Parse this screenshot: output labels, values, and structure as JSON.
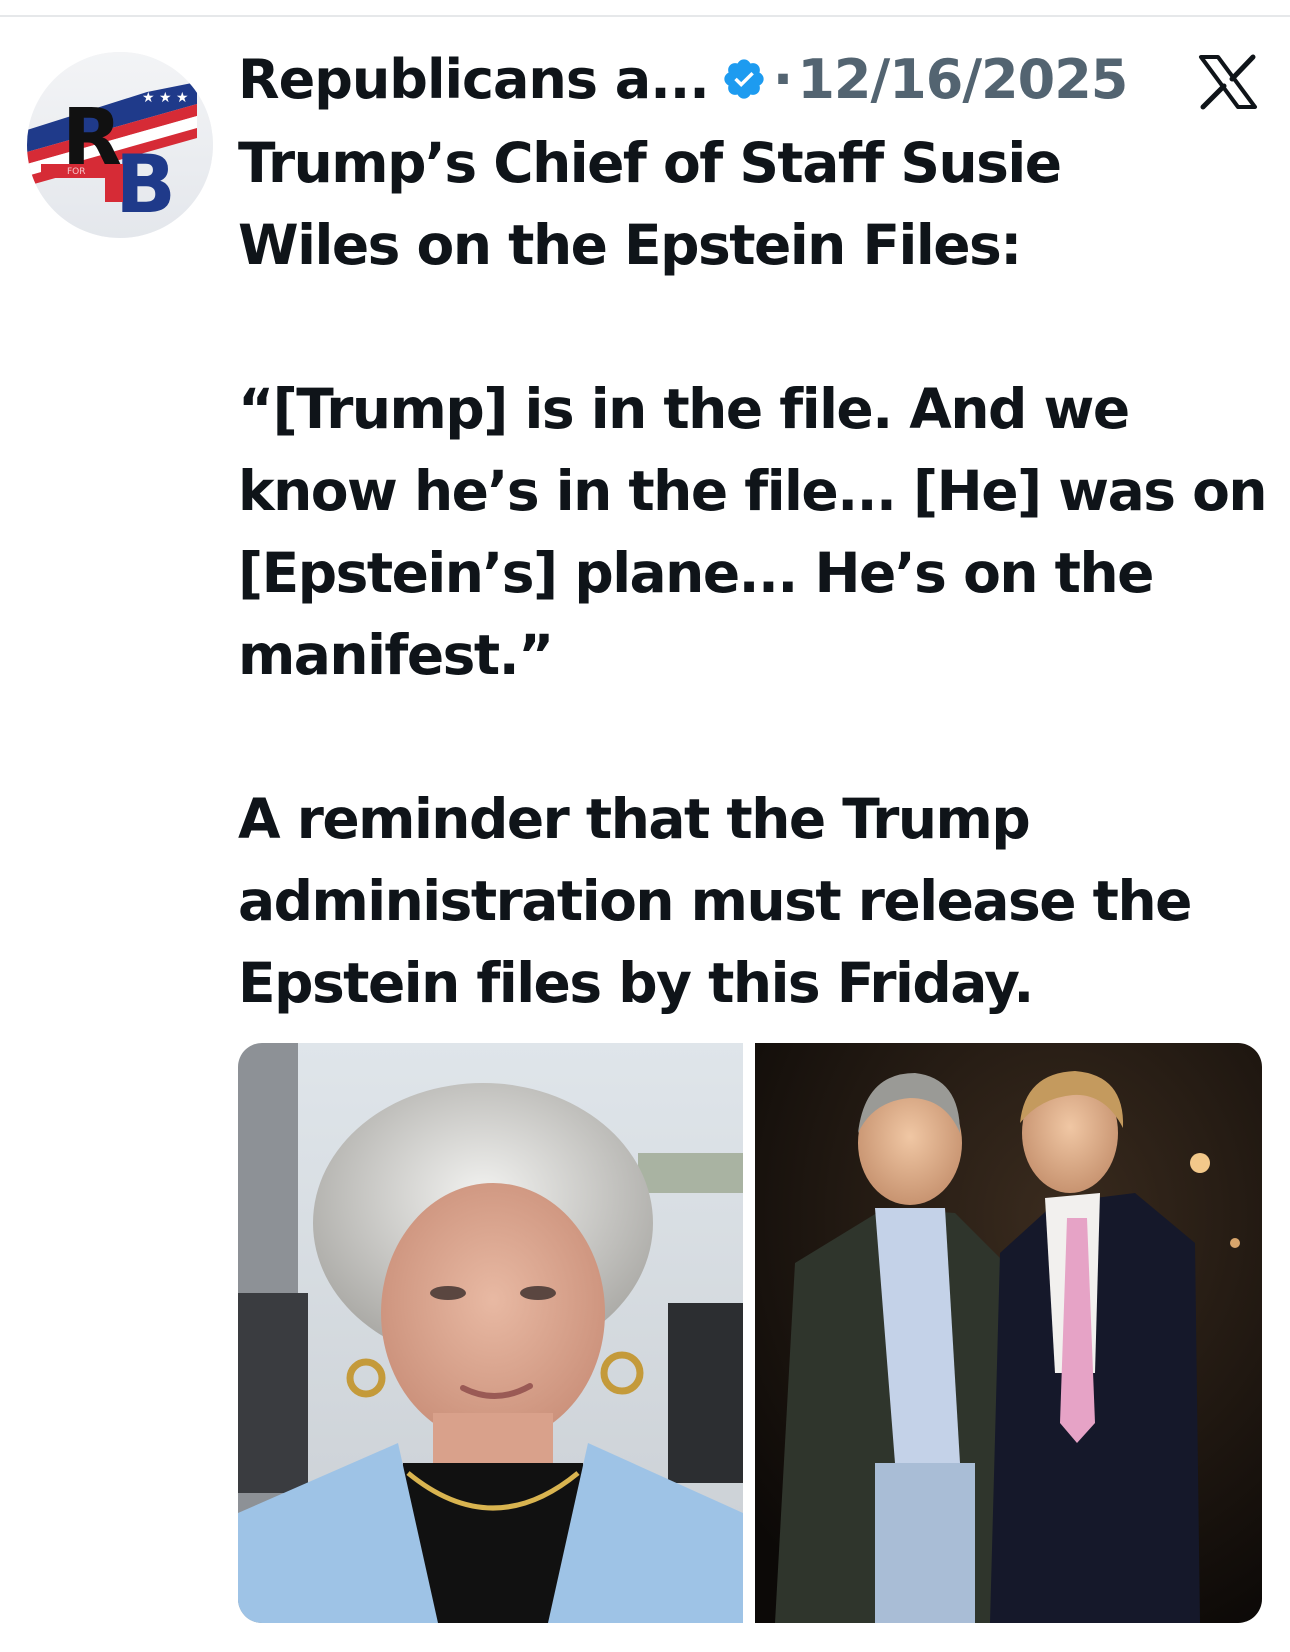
{
  "tweet": {
    "author": {
      "display_name": "Republicans a...",
      "verified_icon": "verified-badge-icon",
      "avatar_initials": {
        "top": "R",
        "bottom": "B",
        "small": "FOR"
      }
    },
    "separator": "·",
    "timestamp": "12/16/2025",
    "platform_icon": "x-logo-icon",
    "text": {
      "line1": "Trump’s Chief of Staff Susie",
      "line2": "Wiles on the Epstein Files:",
      "quote_line1": "“[Trump] is in the file. And we",
      "quote_line2": "know he’s in the file... [He] was on",
      "quote_line3": "[Epstein’s] plane... He’s on the",
      "quote_line4": "manifest.”",
      "closing_line1": "A reminder that the Trump",
      "closing_line2": "administration must release the",
      "closing_line3": "Epstein files by this Friday."
    },
    "media": [
      {
        "kind": "photo",
        "subject": "woman with short grey hair and light blue jacket"
      },
      {
        "kind": "photo",
        "subject": "two men in suits posing at night event"
      }
    ]
  },
  "colors": {
    "text_primary": "#0f1419",
    "text_secondary": "#536471",
    "verified_blue": "#1d9bf0",
    "divider": "#e6e8ea"
  }
}
